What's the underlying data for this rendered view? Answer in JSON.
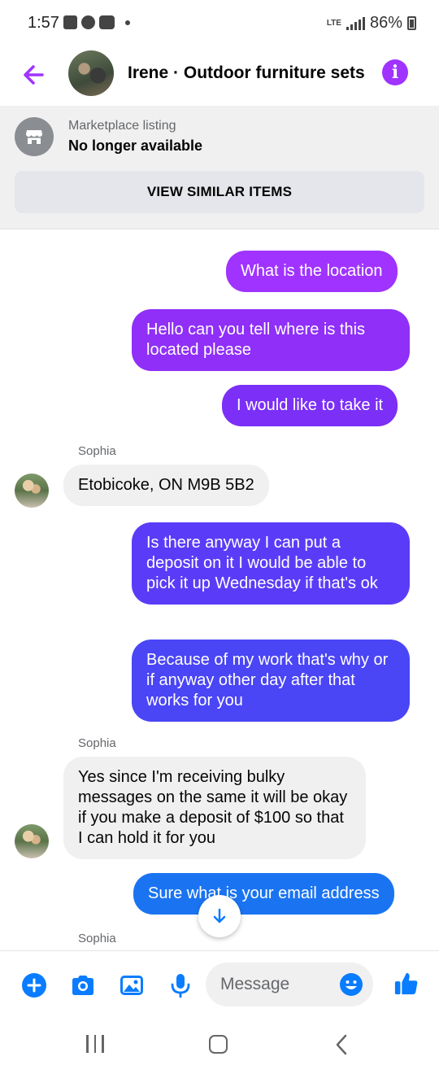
{
  "status_bar": {
    "time": "1:57",
    "network": "LTE",
    "battery": "86%"
  },
  "header": {
    "title": "Irene · Outdoor furniture sets"
  },
  "marketplace": {
    "label": "Marketplace listing",
    "status": "No longer available",
    "button": "VIEW SIMILAR ITEMS"
  },
  "messages": [
    {
      "dir": "out",
      "text": "What is the location"
    },
    {
      "dir": "out",
      "text": "Hello can you tell where is this located please"
    },
    {
      "dir": "out",
      "text": "I would like to take it"
    },
    {
      "dir": "sender",
      "text": "Sophia"
    },
    {
      "dir": "in",
      "text": "Etobicoke, ON M9B 5B2"
    },
    {
      "dir": "out",
      "text": "Is there anyway I can put a deposit on it I would be able to pick it up Wednesday if that's ok"
    },
    {
      "dir": "out",
      "text": "Because of my work that's why or if anyway other day after that works for you"
    },
    {
      "dir": "sender",
      "text": "Sophia"
    },
    {
      "dir": "in",
      "text": "Yes since I'm receiving bulky messages on the same it will be okay if you make a deposit of $100 so that I can hold it for you"
    },
    {
      "dir": "out",
      "text": "Sure what is your email address"
    },
    {
      "dir": "sender",
      "text": "Sophia"
    }
  ],
  "composer": {
    "placeholder": "Message"
  },
  "colors": {
    "accent": "#a033ff",
    "bubble_1": "#a033ff",
    "bubble_2": "#8f2ff7",
    "bubble_3": "#7b2ff7",
    "bubble_4": "#5a3cf8",
    "bubble_5": "#4a45f5",
    "bubble_6": "#1a74f2",
    "icon_blue": "#0a7cff"
  },
  "icons": {
    "back": "arrow-left-icon",
    "info": "info-icon",
    "market": "storefront-icon",
    "scroll": "arrow-down-icon",
    "plus": "plus-icon",
    "camera": "camera-icon",
    "gallery": "image-icon",
    "mic": "microphone-icon",
    "emoji": "emoji-icon",
    "like": "thumbs-up-icon"
  }
}
